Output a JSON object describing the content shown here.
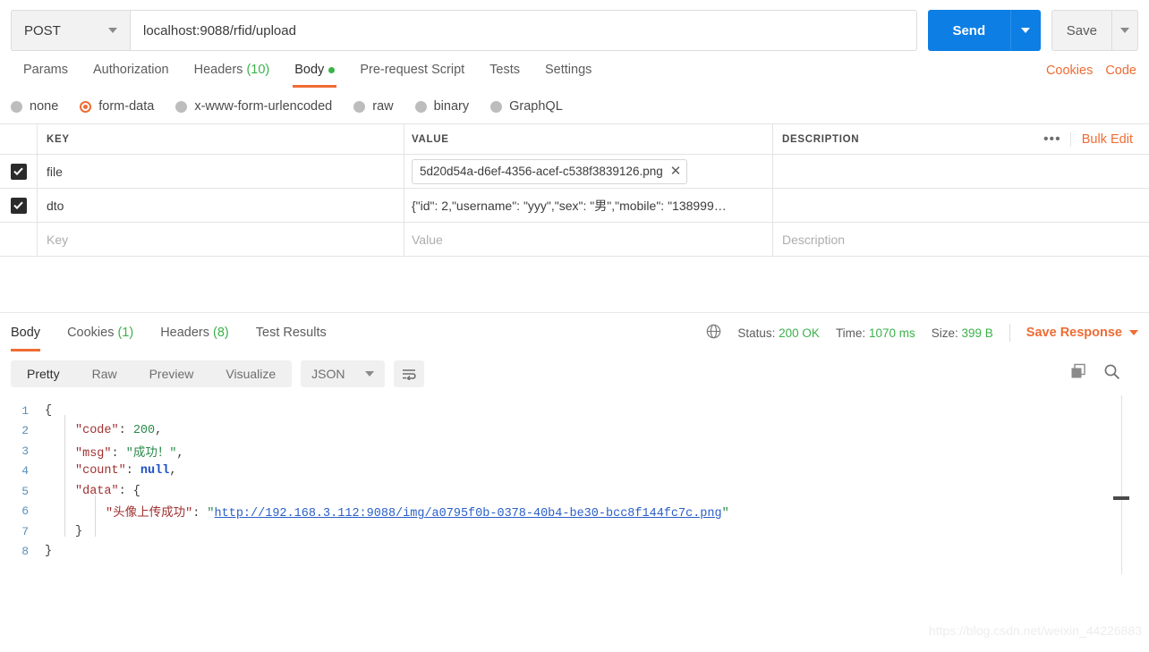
{
  "request": {
    "method": "POST",
    "url": "localhost:9088/rfid/upload",
    "send_label": "Send",
    "save_label": "Save",
    "tabs": [
      {
        "label": "Params",
        "count": "",
        "dot": false,
        "active": false
      },
      {
        "label": "Authorization",
        "count": "",
        "dot": false,
        "active": false
      },
      {
        "label": "Headers",
        "count": "(10)",
        "dot": false,
        "active": false
      },
      {
        "label": "Body",
        "count": "",
        "dot": true,
        "active": true
      },
      {
        "label": "Pre-request Script",
        "count": "",
        "dot": false,
        "active": false
      },
      {
        "label": "Tests",
        "count": "",
        "dot": false,
        "active": false
      },
      {
        "label": "Settings",
        "count": "",
        "dot": false,
        "active": false
      }
    ],
    "cookies_link": "Cookies",
    "code_link": "Code",
    "body_types": [
      {
        "label": "none",
        "selected": false
      },
      {
        "label": "form-data",
        "selected": true
      },
      {
        "label": "x-www-form-urlencoded",
        "selected": false
      },
      {
        "label": "raw",
        "selected": false
      },
      {
        "label": "binary",
        "selected": false
      },
      {
        "label": "GraphQL",
        "selected": false
      }
    ],
    "table": {
      "headers": {
        "key": "KEY",
        "value": "VALUE",
        "description": "DESCRIPTION"
      },
      "bulk_edit": "Bulk Edit",
      "dots": "•••",
      "rows": [
        {
          "checked": true,
          "key": "file",
          "value": "5d20d54a-d6ef-4356-acef-c538f3839126.png",
          "is_file": true,
          "description": ""
        },
        {
          "checked": true,
          "key": "dto",
          "value": "{\"id\": 2,\"username\": \"yyy\",\"sex\": \"男\",\"mobile\": \"138999…",
          "is_file": false,
          "description": ""
        }
      ],
      "placeholder_row": {
        "key": "Key",
        "value": "Value",
        "description": "Description"
      }
    }
  },
  "response": {
    "tabs": [
      {
        "label": "Body",
        "count": "",
        "active": true
      },
      {
        "label": "Cookies",
        "count": "(1)",
        "active": false
      },
      {
        "label": "Headers",
        "count": "(8)",
        "active": false
      },
      {
        "label": "Test Results",
        "count": "",
        "active": false
      }
    ],
    "status_label": "Status:",
    "status_value": "200 OK",
    "time_label": "Time:",
    "time_value": "1070 ms",
    "size_label": "Size:",
    "size_value": "399 B",
    "save_response": "Save Response",
    "view_modes": [
      {
        "label": "Pretty",
        "active": true
      },
      {
        "label": "Raw",
        "active": false
      },
      {
        "label": "Preview",
        "active": false
      },
      {
        "label": "Visualize",
        "active": false
      }
    ],
    "format": "JSON",
    "body_lines": [
      {
        "n": "1",
        "indent": 0,
        "tokens": [
          {
            "t": "{",
            "c": "p"
          }
        ]
      },
      {
        "n": "2",
        "indent": 1,
        "tokens": [
          {
            "t": "\"code\"",
            "c": "k"
          },
          {
            "t": ": ",
            "c": "p"
          },
          {
            "t": "200",
            "c": "n"
          },
          {
            "t": ",",
            "c": "p"
          }
        ]
      },
      {
        "n": "3",
        "indent": 1,
        "tokens": [
          {
            "t": "\"msg\"",
            "c": "k"
          },
          {
            "t": ": ",
            "c": "p"
          },
          {
            "t": "\"成功！\"",
            "c": "s"
          },
          {
            "t": ",",
            "c": "p"
          }
        ]
      },
      {
        "n": "4",
        "indent": 1,
        "tokens": [
          {
            "t": "\"count\"",
            "c": "k"
          },
          {
            "t": ": ",
            "c": "p"
          },
          {
            "t": "null",
            "c": "nul"
          },
          {
            "t": ",",
            "c": "p"
          }
        ]
      },
      {
        "n": "5",
        "indent": 1,
        "tokens": [
          {
            "t": "\"data\"",
            "c": "k"
          },
          {
            "t": ": {",
            "c": "p"
          }
        ]
      },
      {
        "n": "6",
        "indent": 2,
        "tokens": [
          {
            "t": "\"头像上传成功\"",
            "c": "k"
          },
          {
            "t": ": ",
            "c": "p"
          },
          {
            "t": "\"",
            "c": "s"
          },
          {
            "t": "http://192.168.3.112:9088/img/a0795f0b-0378-40b4-be30-bcc8f144fc7c.png",
            "c": "lnk"
          },
          {
            "t": "\"",
            "c": "s"
          }
        ]
      },
      {
        "n": "7",
        "indent": 1,
        "tokens": [
          {
            "t": "}",
            "c": "p"
          }
        ]
      },
      {
        "n": "8",
        "indent": 0,
        "tokens": [
          {
            "t": "}",
            "c": "p"
          }
        ]
      }
    ]
  },
  "watermark": "https://blog.csdn.net/weixin_44226883"
}
